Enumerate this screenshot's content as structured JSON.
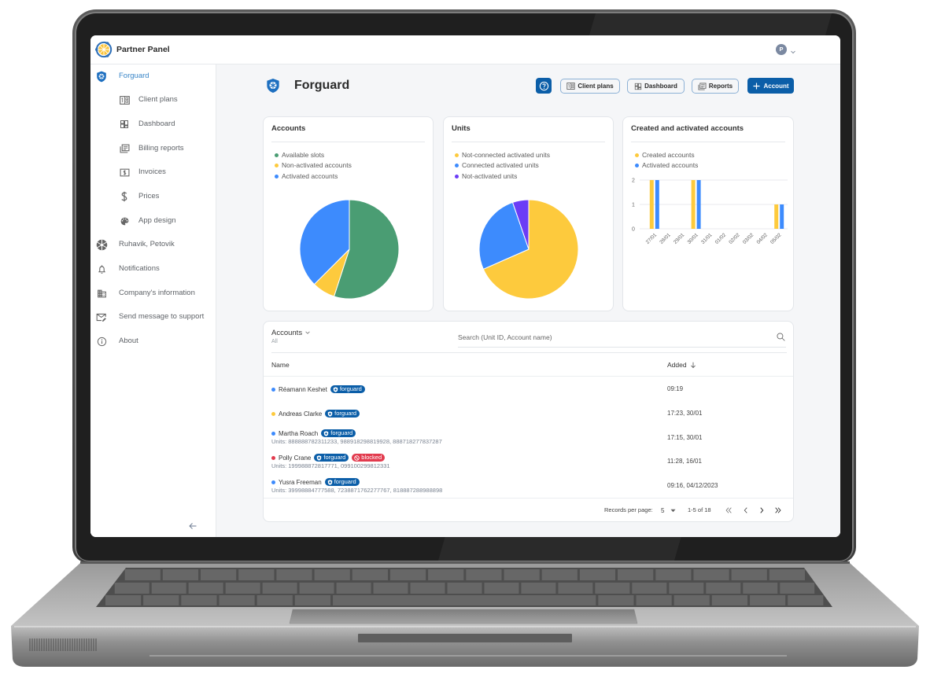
{
  "app": {
    "title": "Partner Panel",
    "user_avatar_initial": "P"
  },
  "sidebar": {
    "items": [
      {
        "label": "Forguard",
        "icon": "forguard-shield-icon",
        "active": true
      },
      {
        "label": "Client plans",
        "icon": "client-plans-icon"
      },
      {
        "label": "Dashboard",
        "icon": "dashboard-icon"
      },
      {
        "label": "Billing reports",
        "icon": "billing-reports-icon"
      },
      {
        "label": "Invoices",
        "icon": "invoice-icon"
      },
      {
        "label": "Prices",
        "icon": "dollar-icon"
      },
      {
        "label": "App design",
        "icon": "palette-icon"
      },
      {
        "label": "Ruhavik, Petovik",
        "icon": "ruhavik-logo-icon"
      },
      {
        "label": "Notifications",
        "icon": "bell-icon"
      },
      {
        "label": "Company's information",
        "icon": "building-icon"
      },
      {
        "label": "Send message to support",
        "icon": "mail-edit-icon"
      },
      {
        "label": "About",
        "icon": "info-icon"
      }
    ],
    "collapse_icon": "arrow-left-icon"
  },
  "page": {
    "title": "Forguard",
    "title_icon": "forguard-shield-icon"
  },
  "toolbar": {
    "help_icon": "help-icon",
    "client_plans": "Client plans",
    "dashboard": "Dashboard",
    "reports": "Reports",
    "add_account": "Account"
  },
  "colors": {
    "primary": "#0b5ea8",
    "active_nav": "#3a86c8",
    "green": "#4a9d73",
    "yellow": "#fdca3d",
    "blue": "#3d8bfd",
    "purple": "#6b3cf6",
    "red": "#e23b4e"
  },
  "chart_data": [
    {
      "type": "pie",
      "title": "Accounts",
      "labels": [
        "Available slots",
        "Non-activated accounts",
        "Activated accounts"
      ],
      "values": [
        22,
        3,
        15
      ],
      "colors": [
        "#4a9d73",
        "#fdca3d",
        "#3d8bfd"
      ],
      "start": "top",
      "direction": "clockwise",
      "legend": "top-left"
    },
    {
      "type": "pie",
      "title": "Units",
      "labels": [
        "Not-connected activated units",
        "Connected activated units",
        "Not-activated units"
      ],
      "values": [
        13,
        5,
        1
      ],
      "colors": [
        "#fdca3d",
        "#3d8bfd",
        "#6b3cf6"
      ],
      "start": "top",
      "direction": "clockwise",
      "legend": "top-left"
    },
    {
      "type": "bar",
      "title": "Created and activated accounts",
      "categories": [
        "27/01",
        "28/01",
        "29/01",
        "30/01",
        "31/01",
        "01/02",
        "02/02",
        "03/02",
        "04/02",
        "05/02"
      ],
      "series": [
        {
          "name": "Created accounts",
          "color": "#fdca3d",
          "values": [
            2,
            0,
            0,
            2,
            0,
            0,
            0,
            0,
            0,
            1
          ]
        },
        {
          "name": "Activated accounts",
          "color": "#3d8bfd",
          "values": [
            2,
            0,
            0,
            2,
            0,
            0,
            0,
            0,
            0,
            1
          ]
        }
      ],
      "yticks": [
        0,
        1,
        2
      ],
      "ylim": [
        0,
        2
      ],
      "xlabel": "",
      "ylabel": "",
      "grid": true,
      "legend": "top-left"
    }
  ],
  "table": {
    "filter_label": "Accounts",
    "filter_value": "All",
    "search_placeholder": "Search (Unit ID, Account name)",
    "columns": {
      "name": "Name",
      "added": "Added"
    },
    "sort_direction": "descending",
    "badges": {
      "forguard": "forguard",
      "blocked": "blocked"
    },
    "rows": [
      {
        "name": "Réamann Keshet",
        "status_color": "#3d8bfd",
        "units": "",
        "added": "09:19",
        "blocked": false
      },
      {
        "name": "Andreas Clarke",
        "status_color": "#fdca3d",
        "units": "",
        "added": "17:23, 30/01",
        "blocked": false
      },
      {
        "name": "Martha Roach",
        "status_color": "#3d8bfd",
        "units": "Units: 888888782311233, 988918298819928, 888718277837287",
        "added": "17:15, 30/01",
        "blocked": false
      },
      {
        "name": "Polly Crane",
        "status_color": "#e23b4e",
        "units": "Units: 199988872817771, 099100299812331",
        "added": "11:28, 16/01",
        "blocked": true
      },
      {
        "name": "Yusra Freeman",
        "status_color": "#3d8bfd",
        "units": "Units: 39998884777588, 7238871762277767, 818887288988898",
        "added": "09:16, 04/12/2023",
        "blocked": false
      }
    ],
    "pagination": {
      "records_per_page_label": "Records per page:",
      "records_per_page": "5",
      "range": "1-5 of 18"
    }
  }
}
